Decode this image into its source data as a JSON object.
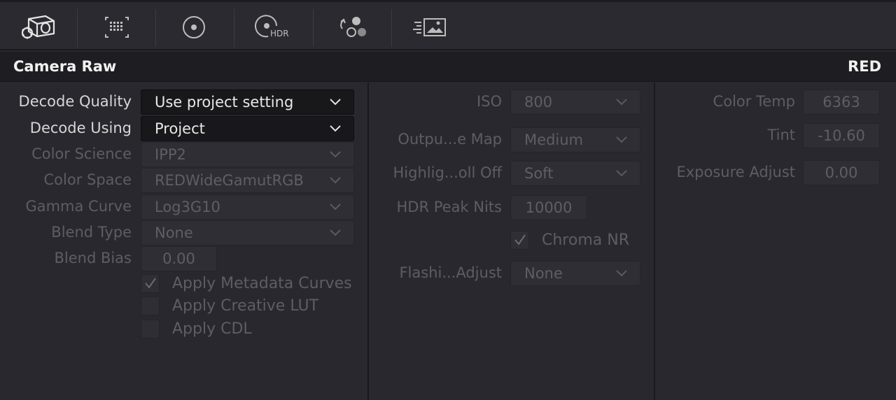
{
  "toolbar": {
    "tools": [
      {
        "name": "camera-raw-icon"
      },
      {
        "name": "color-match-icon"
      },
      {
        "name": "primaries-icon"
      },
      {
        "name": "hdr-icon",
        "label": "HDR"
      },
      {
        "name": "rgb-mixer-icon"
      },
      {
        "name": "motion-effects-icon"
      }
    ]
  },
  "header": {
    "title": "Camera Raw",
    "brand": "RED"
  },
  "left": {
    "decode_quality": {
      "label": "Decode Quality",
      "value": "Use project setting"
    },
    "decode_using": {
      "label": "Decode Using",
      "value": "Project"
    },
    "color_science": {
      "label": "Color Science",
      "value": "IPP2"
    },
    "color_space": {
      "label": "Color Space",
      "value": "REDWideGamutRGB"
    },
    "gamma_curve": {
      "label": "Gamma Curve",
      "value": "Log3G10"
    },
    "blend_type": {
      "label": "Blend Type",
      "value": "None"
    },
    "blend_bias": {
      "label": "Blend Bias",
      "value": "0.00"
    },
    "apply_metadata_curves": {
      "label": "Apply Metadata Curves",
      "checked": true
    },
    "apply_creative_lut": {
      "label": "Apply Creative LUT",
      "checked": false
    },
    "apply_cdl": {
      "label": "Apply CDL",
      "checked": false
    }
  },
  "middle": {
    "iso": {
      "label": "ISO",
      "value": "800"
    },
    "output_tone_map": {
      "label": "Outpu...e Map",
      "value": "Medium"
    },
    "highlight_rolloff": {
      "label": "Highlig...oll Off",
      "value": "Soft"
    },
    "hdr_peak_nits": {
      "label": "HDR Peak Nits",
      "value": "10000"
    },
    "chroma_nr": {
      "label": "Chroma NR",
      "checked": true
    },
    "flashing_adjust": {
      "label": "Flashi...Adjust",
      "value": "None"
    }
  },
  "right": {
    "color_temp": {
      "label": "Color Temp",
      "value": "6363"
    },
    "tint": {
      "label": "Tint",
      "value": "-10.60"
    },
    "exposure_adjust": {
      "label": "Exposure Adjust",
      "value": "0.00"
    }
  }
}
